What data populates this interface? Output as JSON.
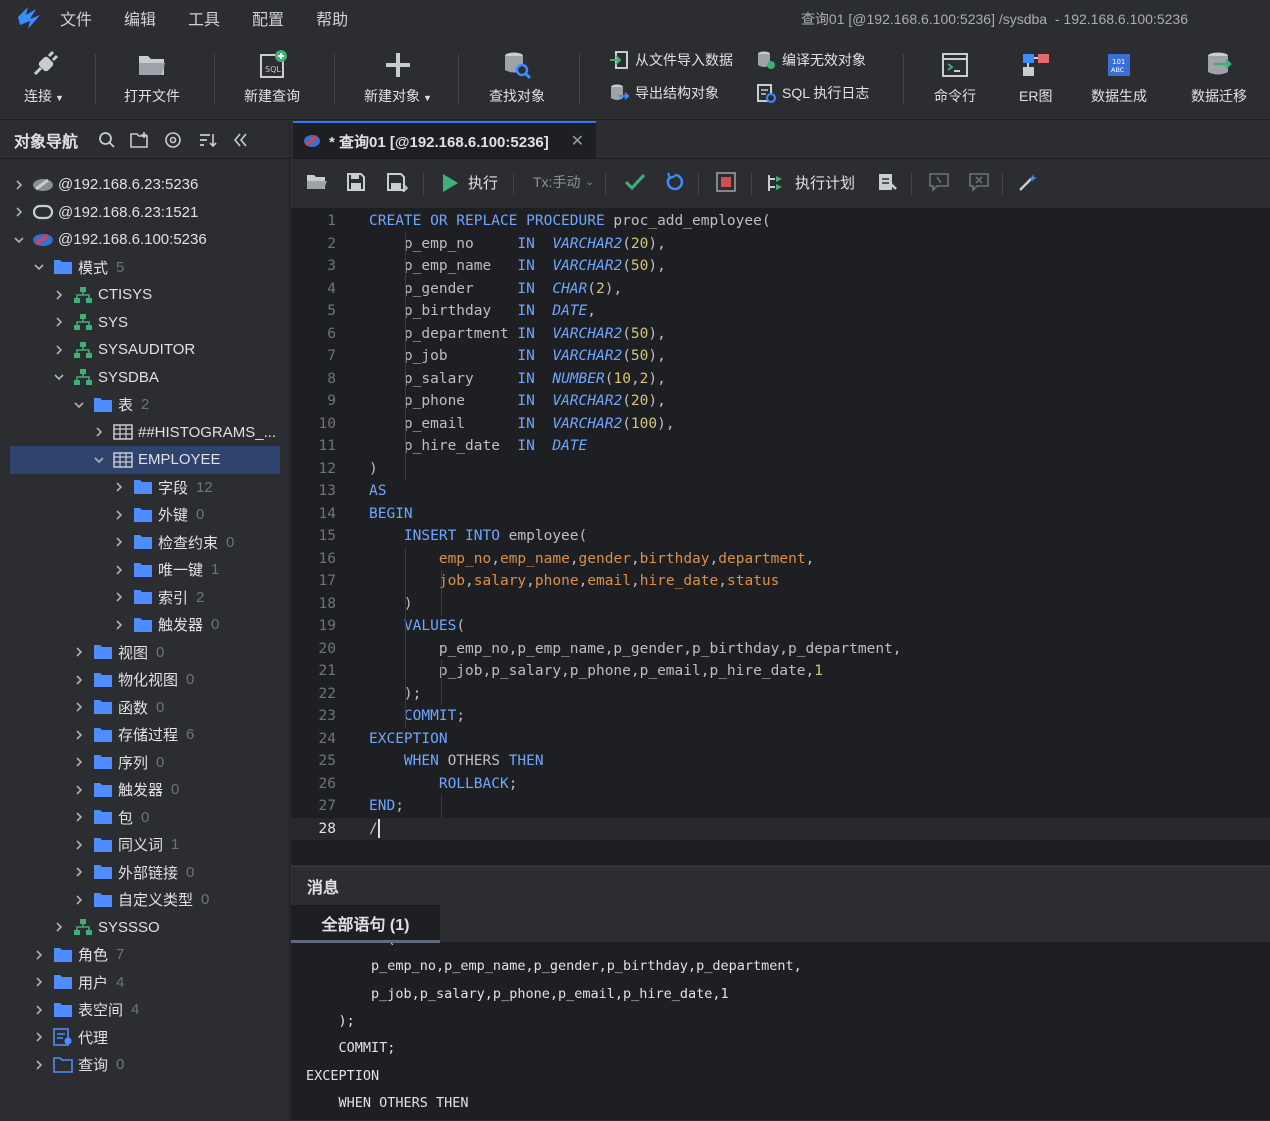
{
  "menu": {
    "items": [
      "文件",
      "编辑",
      "工具",
      "配置",
      "帮助"
    ],
    "window_title": "查询01 [@192.168.6.100:5236] /sysdba  - 192.168.6.100:5236"
  },
  "toolbar": {
    "connect": "连接",
    "open_file": "打开文件",
    "new_query": "新建查询",
    "new_object": "新建对象",
    "find_object": "查找对象",
    "import_data": "从文件导入数据",
    "export_struct": "导出结构对象",
    "compile_invalid": "编译无效对象",
    "sql_log": "SQL 执行日志",
    "cmd": "命令行",
    "er": "ER图",
    "data_gen": "数据生成",
    "data_migrate": "数据迁移"
  },
  "nav": {
    "title": "对象导航",
    "tree": [
      {
        "label": "@192.168.6.23:5236",
        "count": "",
        "level": 0,
        "icon": "server-gray-icon",
        "state": "collapsed"
      },
      {
        "label": "@192.168.6.23:1521",
        "count": "",
        "level": 0,
        "icon": "oracle-server-icon",
        "state": "collapsed"
      },
      {
        "label": "@192.168.6.100:5236",
        "count": "",
        "level": 0,
        "icon": "dm-server-icon",
        "state": "expanded"
      },
      {
        "label": "模式",
        "count": "5",
        "level": 1,
        "icon": "folder-icon",
        "state": "expanded"
      },
      {
        "label": "CTISYS",
        "count": "",
        "level": 2,
        "icon": "schema-icon",
        "state": "collapsed"
      },
      {
        "label": "SYS",
        "count": "",
        "level": 2,
        "icon": "schema-icon",
        "state": "collapsed"
      },
      {
        "label": "SYSAUDITOR",
        "count": "",
        "level": 2,
        "icon": "schema-icon",
        "state": "collapsed"
      },
      {
        "label": "SYSDBA",
        "count": "",
        "level": 2,
        "icon": "schema-icon",
        "state": "expanded"
      },
      {
        "label": "表",
        "count": "2",
        "level": 3,
        "icon": "folder-icon",
        "state": "expanded"
      },
      {
        "label": "##HISTOGRAMS_...",
        "count": "",
        "level": 4,
        "icon": "table-icon",
        "state": "collapsed"
      },
      {
        "label": "EMPLOYEE",
        "count": "",
        "level": 4,
        "icon": "table-icon",
        "state": "expanded",
        "selected": true
      },
      {
        "label": "字段",
        "count": "12",
        "level": 5,
        "icon": "folder-icon",
        "state": "collapsed"
      },
      {
        "label": "外键",
        "count": "0",
        "level": 5,
        "icon": "folder-icon",
        "state": "collapsed"
      },
      {
        "label": "检查约束",
        "count": "0",
        "level": 5,
        "icon": "folder-icon",
        "state": "collapsed"
      },
      {
        "label": "唯一键",
        "count": "1",
        "level": 5,
        "icon": "folder-icon",
        "state": "collapsed"
      },
      {
        "label": "索引",
        "count": "2",
        "level": 5,
        "icon": "folder-icon",
        "state": "collapsed"
      },
      {
        "label": "触发器",
        "count": "0",
        "level": 5,
        "icon": "folder-icon",
        "state": "collapsed"
      },
      {
        "label": "视图",
        "count": "0",
        "level": 3,
        "icon": "folder-icon",
        "state": "collapsed"
      },
      {
        "label": "物化视图",
        "count": "0",
        "level": 3,
        "icon": "folder-icon",
        "state": "collapsed"
      },
      {
        "label": "函数",
        "count": "0",
        "level": 3,
        "icon": "folder-icon",
        "state": "collapsed"
      },
      {
        "label": "存储过程",
        "count": "6",
        "level": 3,
        "icon": "folder-icon",
        "state": "collapsed"
      },
      {
        "label": "序列",
        "count": "0",
        "level": 3,
        "icon": "folder-icon",
        "state": "collapsed"
      },
      {
        "label": "触发器",
        "count": "0",
        "level": 3,
        "icon": "folder-icon",
        "state": "collapsed"
      },
      {
        "label": "包",
        "count": "0",
        "level": 3,
        "icon": "folder-icon",
        "state": "collapsed"
      },
      {
        "label": "同义词",
        "count": "1",
        "level": 3,
        "icon": "folder-icon",
        "state": "collapsed"
      },
      {
        "label": "外部链接",
        "count": "0",
        "level": 3,
        "icon": "folder-icon",
        "state": "collapsed"
      },
      {
        "label": "自定义类型",
        "count": "0",
        "level": 3,
        "icon": "folder-icon",
        "state": "collapsed"
      },
      {
        "label": "SYSSSO",
        "count": "",
        "level": 2,
        "icon": "schema-icon",
        "state": "collapsed"
      },
      {
        "label": "角色",
        "count": "7",
        "level": 1,
        "icon": "folder-icon",
        "state": "collapsed"
      },
      {
        "label": "用户",
        "count": "4",
        "level": 1,
        "icon": "folder-icon",
        "state": "collapsed"
      },
      {
        "label": "表空间",
        "count": "4",
        "level": 1,
        "icon": "folder-icon",
        "state": "collapsed"
      },
      {
        "label": "代理",
        "count": "",
        "level": 1,
        "icon": "agent-icon",
        "state": "collapsed"
      },
      {
        "label": "查询",
        "count": "0",
        "level": 1,
        "icon": "folder-outline-icon",
        "state": "collapsed"
      }
    ]
  },
  "editor": {
    "tab_title": "* 查询01 [@192.168.6.100:5236]",
    "execute": "执行",
    "tx_mode": "Tx:手动",
    "exec_plan": "执行计划",
    "lines": [
      [
        [
          "kw",
          "CREATE OR REPLACE PROCEDURE"
        ],
        [
          "t",
          " proc_add_employee("
        ]
      ],
      [
        [
          "t",
          "    p_emp_no     "
        ],
        [
          "kw",
          "IN"
        ],
        [
          "t",
          "  "
        ],
        [
          "ty",
          "VARCHAR2"
        ],
        [
          "t",
          "("
        ],
        [
          "nm",
          "20"
        ],
        [
          "t",
          "),"
        ]
      ],
      [
        [
          "t",
          "    p_emp_name   "
        ],
        [
          "kw",
          "IN"
        ],
        [
          "t",
          "  "
        ],
        [
          "ty",
          "VARCHAR2"
        ],
        [
          "t",
          "("
        ],
        [
          "nm",
          "50"
        ],
        [
          "t",
          "),"
        ]
      ],
      [
        [
          "t",
          "    p_gender     "
        ],
        [
          "kw",
          "IN"
        ],
        [
          "t",
          "  "
        ],
        [
          "ty",
          "CHAR"
        ],
        [
          "t",
          "("
        ],
        [
          "nm",
          "2"
        ],
        [
          "t",
          "),"
        ]
      ],
      [
        [
          "t",
          "    p_birthday   "
        ],
        [
          "kw",
          "IN"
        ],
        [
          "t",
          "  "
        ],
        [
          "ty",
          "DATE"
        ],
        [
          "t",
          ","
        ]
      ],
      [
        [
          "t",
          "    p_department "
        ],
        [
          "kw",
          "IN"
        ],
        [
          "t",
          "  "
        ],
        [
          "ty",
          "VARCHAR2"
        ],
        [
          "t",
          "("
        ],
        [
          "nm",
          "50"
        ],
        [
          "t",
          "),"
        ]
      ],
      [
        [
          "t",
          "    p_job        "
        ],
        [
          "kw",
          "IN"
        ],
        [
          "t",
          "  "
        ],
        [
          "ty",
          "VARCHAR2"
        ],
        [
          "t",
          "("
        ],
        [
          "nm",
          "50"
        ],
        [
          "t",
          "),"
        ]
      ],
      [
        [
          "t",
          "    p_salary     "
        ],
        [
          "kw",
          "IN"
        ],
        [
          "t",
          "  "
        ],
        [
          "ty",
          "NUMBER"
        ],
        [
          "t",
          "("
        ],
        [
          "nm",
          "10"
        ],
        [
          "t",
          ","
        ],
        [
          "nm",
          "2"
        ],
        [
          "t",
          "),"
        ]
      ],
      [
        [
          "t",
          "    p_phone      "
        ],
        [
          "kw",
          "IN"
        ],
        [
          "t",
          "  "
        ],
        [
          "ty",
          "VARCHAR2"
        ],
        [
          "t",
          "("
        ],
        [
          "nm",
          "20"
        ],
        [
          "t",
          "),"
        ]
      ],
      [
        [
          "t",
          "    p_email      "
        ],
        [
          "kw",
          "IN"
        ],
        [
          "t",
          "  "
        ],
        [
          "ty",
          "VARCHAR2"
        ],
        [
          "t",
          "("
        ],
        [
          "nm",
          "100"
        ],
        [
          "t",
          "),"
        ]
      ],
      [
        [
          "t",
          "    p_hire_date  "
        ],
        [
          "kw",
          "IN"
        ],
        [
          "t",
          "  "
        ],
        [
          "ty",
          "DATE"
        ]
      ],
      [
        [
          "t",
          ")"
        ]
      ],
      [
        [
          "kw",
          "AS"
        ]
      ],
      [
        [
          "kw",
          "BEGIN"
        ]
      ],
      [
        [
          "t",
          "    "
        ],
        [
          "kw",
          "INSERT INTO"
        ],
        [
          "t",
          " employee("
        ]
      ],
      [
        [
          "t",
          "        "
        ],
        [
          "col",
          "emp_no"
        ],
        [
          "t",
          ","
        ],
        [
          "col",
          "emp_name"
        ],
        [
          "t",
          ","
        ],
        [
          "col",
          "gender"
        ],
        [
          "t",
          ","
        ],
        [
          "col",
          "birthday"
        ],
        [
          "t",
          ","
        ],
        [
          "col",
          "department"
        ],
        [
          "t",
          ","
        ]
      ],
      [
        [
          "t",
          "        "
        ],
        [
          "col",
          "job"
        ],
        [
          "t",
          ","
        ],
        [
          "col",
          "salary"
        ],
        [
          "t",
          ","
        ],
        [
          "col",
          "phone"
        ],
        [
          "t",
          ","
        ],
        [
          "col",
          "email"
        ],
        [
          "t",
          ","
        ],
        [
          "col",
          "hire_date"
        ],
        [
          "t",
          ","
        ],
        [
          "col",
          "status"
        ]
      ],
      [
        [
          "t",
          "    )"
        ]
      ],
      [
        [
          "t",
          "    "
        ],
        [
          "kw",
          "VALUES"
        ],
        [
          "t",
          "("
        ]
      ],
      [
        [
          "t",
          "        p_emp_no,p_emp_name,p_gender,p_birthday,p_department,"
        ]
      ],
      [
        [
          "t",
          "        p_job,p_salary,p_phone,p_email,p_hire_date,"
        ],
        [
          "nm",
          "1"
        ]
      ],
      [
        [
          "t",
          "    );"
        ]
      ],
      [
        [
          "t",
          "    "
        ],
        [
          "kw",
          "COMMIT"
        ],
        [
          "t",
          ";"
        ]
      ],
      [
        [
          "kw",
          "EXCEPTION"
        ]
      ],
      [
        [
          "t",
          "    "
        ],
        [
          "kw",
          "WHEN"
        ],
        [
          "t",
          " OTHERS "
        ],
        [
          "kw",
          "THEN"
        ]
      ],
      [
        [
          "t",
          "        "
        ],
        [
          "kw",
          "ROLLBACK"
        ],
        [
          "t",
          ";"
        ]
      ],
      [
        [
          "kw",
          "END"
        ],
        [
          "t",
          ";"
        ]
      ],
      [
        [
          "t",
          "/"
        ]
      ]
    ]
  },
  "messages": {
    "title": "消息",
    "tab_label": "全部语句 (1)",
    "lines": [
      "    VALUES(",
      "        p_emp_no,p_emp_name,p_gender,p_birthday,p_department,",
      "        p_job,p_salary,p_phone,p_email,p_hire_date,1",
      "    );",
      "    COMMIT;",
      "EXCEPTION",
      "    WHEN OTHERS THEN"
    ]
  },
  "colors": {
    "accent": "#3574f0",
    "keyword": "#6fa6ff",
    "number": "#d7c47a",
    "column": "#d9904a",
    "selection": "#2e436e"
  }
}
